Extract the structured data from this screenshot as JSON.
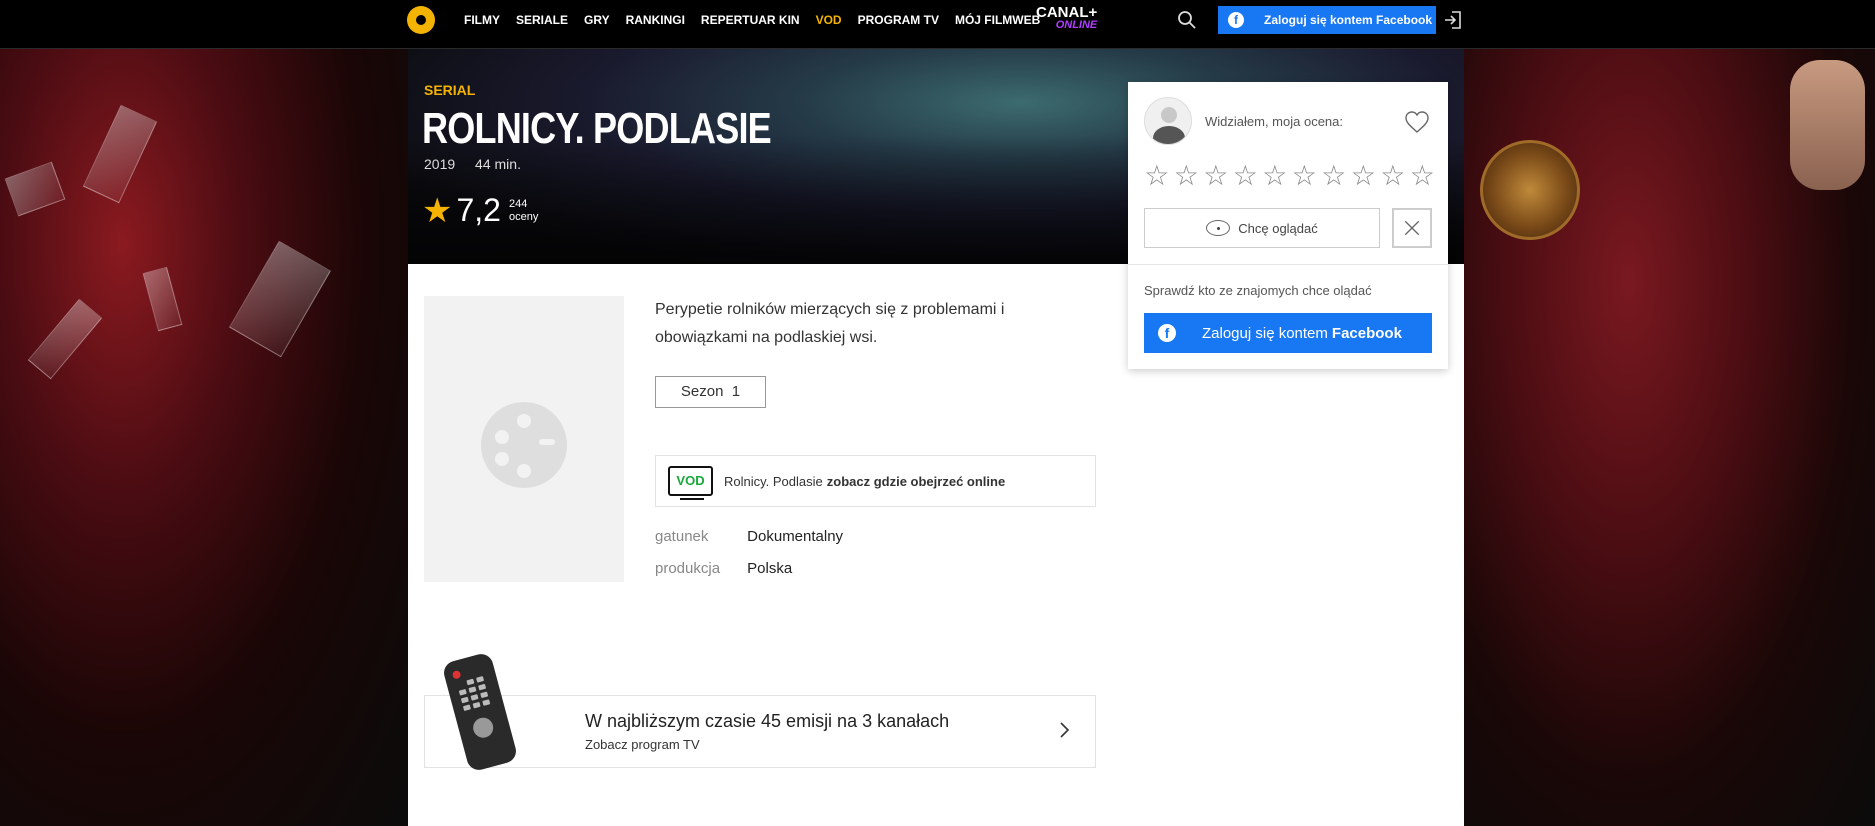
{
  "nav": {
    "items": [
      {
        "label": "FILMY"
      },
      {
        "label": "SERIALE"
      },
      {
        "label": "GRY"
      },
      {
        "label": "RANKINGI"
      },
      {
        "label": "REPERTUAR KIN"
      },
      {
        "label": "VOD",
        "active": true
      },
      {
        "label": "PROGRAM TV"
      },
      {
        "label": "MÓJ FILMWEB"
      }
    ],
    "canal_top": "CANAL+",
    "canal_bottom": "ONLINE",
    "fb_login": "Zaloguj się kontem Facebook",
    "icons": [
      "logo-icon",
      "search-icon",
      "login-icon",
      "facebook-icon"
    ]
  },
  "hero": {
    "type": "SERIAL",
    "title": "ROLNICY. PODLASIE",
    "year": "2019",
    "duration": "44 min.",
    "rating": "7,2",
    "votes": "244",
    "votes_label": "oceny"
  },
  "main": {
    "description": "Perypetie rolników mierzących się z problemami i obowiązkami na podlaskiej wsi.",
    "season_label": "Sezon",
    "season_value": "1",
    "vod_logo": "VOD",
    "vod_title": "Rolnicy. Podlasie",
    "vod_link": "zobacz gdzie obejrzeć online",
    "info": [
      {
        "key": "gatunek",
        "value": "Dokumentalny"
      },
      {
        "key": "produkcja",
        "value": "Polska"
      }
    ]
  },
  "tv": {
    "title": "W najbliższym czasie 45 emisji na 3 kanałach",
    "subtitle": "Zobacz program TV"
  },
  "panel": {
    "seen_label": "Widziałem, moja ocena:",
    "star_count": 10,
    "want_watch": "Chcę oglądać",
    "friends_text": "Sprawdź kto ze znajomych chce olądać",
    "fb_prefix": "Zaloguj się kontem",
    "fb_bold": "Facebook"
  },
  "colors": {
    "accent": "#f5b301",
    "facebook": "#1877f2",
    "vod_green": "#1aa83a"
  }
}
